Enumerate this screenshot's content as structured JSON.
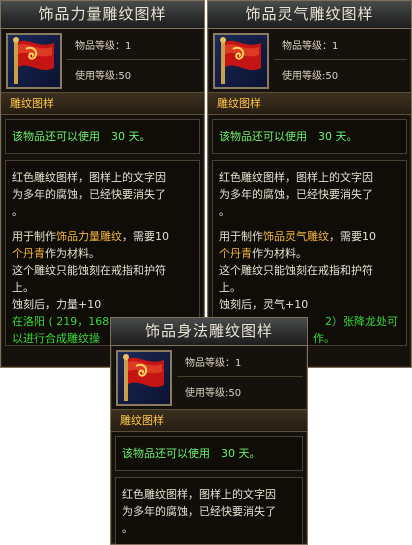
{
  "colors": {
    "panel_bg": "#15110c",
    "border": "#7e6f5a",
    "category": "#ffc74a",
    "remaining_days": "#6df26a",
    "gold_text": "#f3b63a",
    "green_text": "#38d838"
  },
  "icon": "red-flag-scroll-icon",
  "tooltip_left": {
    "title": "饰品力量雕纹图样",
    "item_level": "物品等级：1",
    "use_level": "使用等级:50",
    "category": "雕纹图样",
    "remaining": "该物品还可以使用　30 天。",
    "desc_line1": "红色雕纹图样，图样上的文字因",
    "desc_line2": "为多年的腐蚀，已经快要消失了",
    "desc_line3": "。",
    "use_pre": "用于制作",
    "use_item": "饰品力量雕纹",
    "use_post": "，需要10",
    "mat_item": "个丹青",
    "mat_post": "作为材料。",
    "restrict_line1": "这个雕纹只能蚀刻在戒指和护符",
    "restrict_line2": "上。",
    "effect": "蚀刻后，力量+10",
    "loc_line1": "在洛阳 ( 219，168",
    "loc_line2": "以进行合成雕纹操"
  },
  "tooltip_right": {
    "title": "饰品灵气雕纹图样",
    "item_level": "物品等级：1",
    "use_level": "使用等级:50",
    "category": "雕纹图样",
    "remaining": "该物品还可以使用　30 天。",
    "desc_line1": "红色雕纹图样，图样上的文字因",
    "desc_line2": "为多年的腐蚀，已经快要消失了",
    "desc_line3": "。",
    "use_pre": "用于制作",
    "use_item": "饰品灵气雕纹",
    "use_post": "，需要10",
    "mat_item": "个丹青",
    "mat_post": "作为材料。",
    "restrict_line1": "这个雕纹只能蚀刻在戒指和护符",
    "restrict_line2": "上。",
    "effect": "蚀刻后，灵气+10",
    "loc_line1": "2）张降龙处可",
    "loc_line2": "作。"
  },
  "tooltip_bottom": {
    "title": "饰品身法雕纹图样",
    "item_level": "物品等级：1",
    "use_level": "使用等级:50",
    "category": "雕纹图样",
    "remaining": "该物品还可以使用　30 天。",
    "desc_line1": "红色雕纹图样，图样上的文字因",
    "desc_line2": "为多年的腐蚀，已经快要消失了",
    "desc_line3": "。"
  }
}
